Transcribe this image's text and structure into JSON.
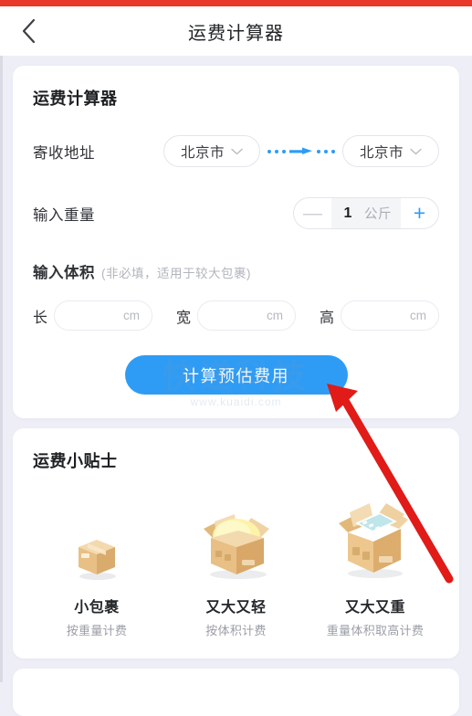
{
  "statusbar": {
    "color": "#e8382c"
  },
  "nav": {
    "back_icon": "chevron-left-icon",
    "title": "运费计算器"
  },
  "calculator": {
    "title": "运费计算器",
    "address": {
      "label": "寄收地址",
      "from": {
        "value": "北京市",
        "icon": "chevron-down-icon"
      },
      "to": {
        "value": "北京市",
        "icon": "chevron-down-icon"
      },
      "connector_icon": "dotted-arrow-right-icon"
    },
    "weight": {
      "label": "输入重量",
      "minus": "—",
      "value": "1",
      "unit": "公斤",
      "plus": "+"
    },
    "volume": {
      "title": "输入体积",
      "hint": "(非必填，适用于较大包裹)",
      "fields": [
        {
          "label": "长",
          "value": "",
          "unit": "cm"
        },
        {
          "label": "宽",
          "value": "",
          "unit": "cm"
        },
        {
          "label": "高",
          "value": "",
          "unit": "cm"
        }
      ]
    },
    "submit_label": "计算预估费用",
    "watermark": "快递科技",
    "watermark_sub": "www.kuaidi.com"
  },
  "tips": {
    "title": "运费小贴士",
    "items": [
      {
        "icon": "small-closed-box-icon",
        "name": "小包裹",
        "desc": "按重量计费"
      },
      {
        "icon": "open-box-light-item-icon",
        "name": "又大又轻",
        "desc": "按体积计费"
      },
      {
        "icon": "open-box-heavy-item-icon",
        "name": "又大又重",
        "desc": "重量体积取高计费"
      }
    ]
  },
  "annotation": {
    "arrow_icon": "red-arrow-pointing-to-submit",
    "color": "#e01b18"
  },
  "colors": {
    "accent": "#2e9cf5",
    "background": "#edeef6",
    "card": "#ffffff",
    "status_bar": "#e8382c",
    "annotation": "#e01b18"
  }
}
